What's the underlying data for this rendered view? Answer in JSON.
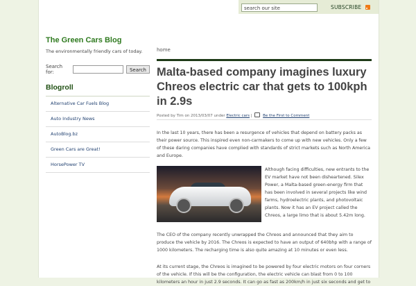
{
  "header": {
    "search_placeholder": "search our site",
    "subscribe_label": "SUBSCRIBE"
  },
  "sidebar": {
    "blog_title": "The Green Cars Blog",
    "tagline": "The environmentally friendly cars of today.",
    "search_label": "Search for:",
    "search_button": "Search",
    "blogroll_title": "Blogroll",
    "blogroll": [
      "Alternative Car Fuels Blog",
      "Auto Industry News",
      "AutoBlog.bz",
      "Green Cars are Great!",
      "HorsePower TV"
    ]
  },
  "post": {
    "breadcrumb": "home",
    "title": "Malta-based company imagines luxury Chreos electric car that gets to 100kph in 2.9s",
    "meta_prefix": "Posted by Tim on 2013/03/07 under",
    "category": "Electric cars",
    "separator": "|",
    "comment_link": "Be the First to Comment",
    "paragraph1": "In the last 10 years, there has been a resurgence of vehicles that depend on battery packs as their power source. This inspired even non-carmakers to come up with new vehicles. Only a few of these daring companies have complied with standards of strict markets such as North America and Europe.",
    "paragraph2": "Although facing difficulties, new entrants to the EV market have not been disheartened. Silex Power, a Malta-based green-energy firm that has been involved in several projects like wind farms, hydroelectric plants, and photovoltaic plants. Now it has an EV project called the Chreos, a large limo that is about 5.42m long.",
    "paragraph3": "The CEO of the company recently unwrapped the Chreos and announced that they aim to produce the vehicle by 2016. The Chreos is expected to have an output of 640bhp with a range of 1000 kilometers. The recharging time is also quite amazing at 10 minutes or even less.",
    "paragraph4": "At its current stage, the Chreos is imagined to be powered by four electric motors on four corners of the vehicle. If this will be the configuration, the electric vehicle can blast from 0 to 100 kilometers an hour in just 2.9 seconds. It can go as fast as 200km/h in just six seconds and get to"
  }
}
